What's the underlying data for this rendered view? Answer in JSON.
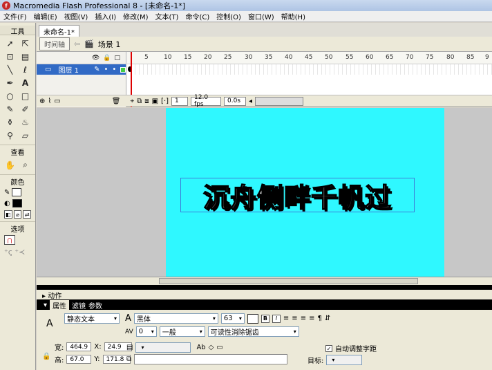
{
  "window": {
    "title": "Macromedia Flash Professional 8 - [未命名-1*]"
  },
  "menu": [
    "文件(F)",
    "编辑(E)",
    "视图(V)",
    "插入(I)",
    "修改(M)",
    "文本(T)",
    "命令(C)",
    "控制(O)",
    "窗口(W)",
    "帮助(H)"
  ],
  "toolbox": {
    "tools_label": "工具",
    "view_label": "查看",
    "color_label": "颜色",
    "options_label": "选项"
  },
  "document": {
    "tab": "未命名-1*",
    "timeline_button": "时间轴",
    "scene": "场景 1"
  },
  "timeline": {
    "layer_name": "图层 1",
    "ruler_marks": [
      "5",
      "10",
      "15",
      "20",
      "25",
      "30",
      "35",
      "40",
      "45",
      "50",
      "55",
      "60",
      "65",
      "70",
      "75",
      "80",
      "85",
      "9"
    ],
    "current_frame": "1",
    "fps": "12.0 fps",
    "time": "0.0s"
  },
  "stage": {
    "text": "沉舟侧畔千帆过",
    "background": "#2ff8ff"
  },
  "panels": {
    "actions": "动作",
    "tabs": [
      "属性",
      "滤镜",
      "参数"
    ]
  },
  "properties": {
    "text_type": "静态文本",
    "font": "黑体",
    "size": "63",
    "letter_spacing": "0",
    "position_mode": "一般",
    "render": "可读性消除锯齿",
    "width_label": "宽:",
    "width": "464.9",
    "height_label": "高:",
    "height": "67.0",
    "x_label": "X:",
    "x": "24.9",
    "y_label": "Y:",
    "y": "171.8",
    "auto_kern": "自动调整字距",
    "target_label": "目标:"
  }
}
